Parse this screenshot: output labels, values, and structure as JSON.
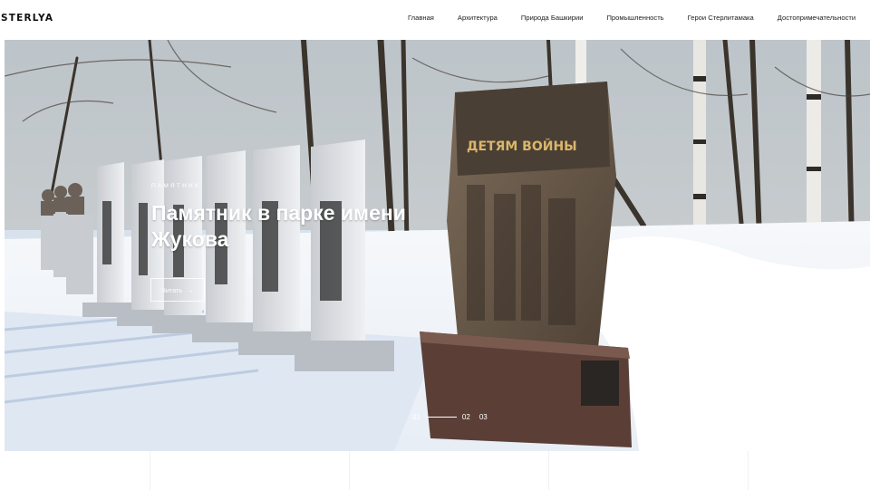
{
  "brand": {
    "logo": "STERLYA"
  },
  "nav": {
    "items": [
      {
        "label": "Главная"
      },
      {
        "label": "Архитектура"
      },
      {
        "label": "Природа Башкирии"
      },
      {
        "label": "Промышленность"
      },
      {
        "label": "Герои Стерлитамака"
      },
      {
        "label": "Достопримечательности"
      }
    ]
  },
  "hero": {
    "eyebrow": "ПАМЯТНИК",
    "title": "Памятник в парке имени Жукова",
    "read_label": "Читать",
    "read_icon": "arrow-right-icon",
    "monument_inscription": "ДЕТЯМ ВОЙНЫ",
    "pager": {
      "first": "01",
      "second": "02",
      "third": "03"
    }
  },
  "colors": {
    "sky": "#cfdce8",
    "snow": "#f3f6fa",
    "shadow": "#a9bdd6",
    "stone": "#8a7a68",
    "granite": "#5a4038"
  }
}
